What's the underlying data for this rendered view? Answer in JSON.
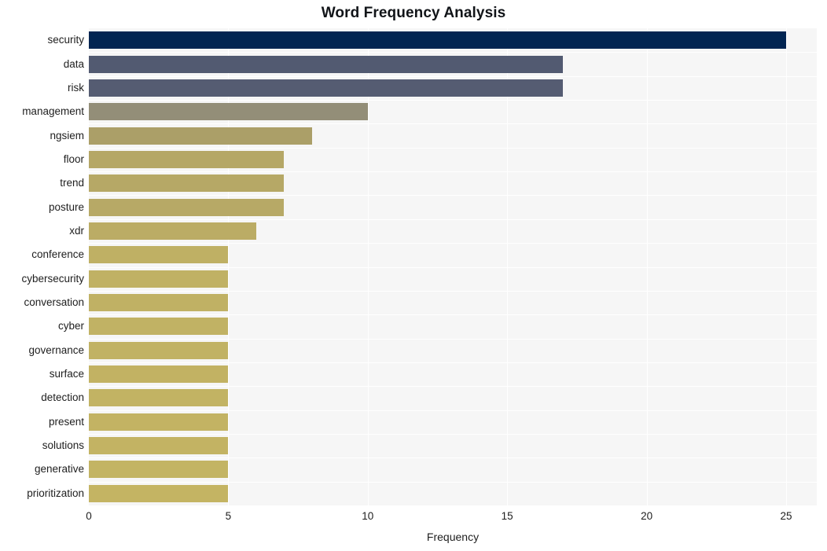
{
  "chart_data": {
    "type": "bar",
    "orientation": "horizontal",
    "title": "Word Frequency Analysis",
    "xlabel": "Frequency",
    "ylabel": "",
    "categories": [
      "security",
      "data",
      "risk",
      "management",
      "ngsiem",
      "floor",
      "trend",
      "posture",
      "xdr",
      "conference",
      "cybersecurity",
      "conversation",
      "cyber",
      "governance",
      "surface",
      "detection",
      "present",
      "solutions",
      "generative",
      "prioritization"
    ],
    "values": [
      25,
      17,
      17,
      10,
      8,
      7,
      7,
      7,
      6,
      5,
      5,
      5,
      5,
      5,
      5,
      5,
      5,
      5,
      5,
      5
    ],
    "bar_colors": [
      "#012552",
      "#525a71",
      "#555c72",
      "#938e78",
      "#ab9f68",
      "#b5a766",
      "#b6a866",
      "#b7a966",
      "#bbac65",
      "#bfb064",
      "#c0b164",
      "#c0b164",
      "#c1b264",
      "#c1b264",
      "#c2b263",
      "#c2b363",
      "#c3b363",
      "#c3b363",
      "#c3b463",
      "#c4b463"
    ],
    "xlim": [
      0,
      26.1
    ],
    "x_ticks": [
      0,
      5,
      10,
      15,
      20,
      25
    ],
    "x_tick_labels": [
      "0",
      "5",
      "10",
      "15",
      "20",
      "25"
    ],
    "grid": true,
    "grid_color": "#ffffff",
    "plot_background": "#f6f6f6",
    "figure_background": "#ffffff",
    "legend": null
  }
}
